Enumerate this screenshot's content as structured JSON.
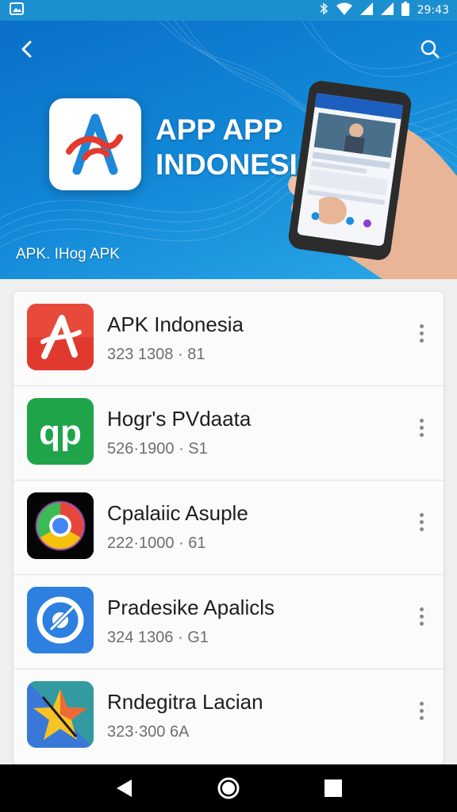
{
  "status_bar": {
    "time": "29:43",
    "icons": [
      "gallery-icon",
      "bluetooth-icon",
      "wifi-icon",
      "signal-icon",
      "signal-icon",
      "battery-icon"
    ]
  },
  "header": {
    "back_icon": "back-arrow-icon",
    "search_icon": "search-icon",
    "title_line1": "APP APP",
    "title_line2": "INDONESI",
    "subtitle": "APK. IHog APK"
  },
  "apps": [
    {
      "name": "APK Indonesia",
      "meta": "323 1308 · 81",
      "icon": "red-a-logo-icon",
      "icon_color": "#e03a2f"
    },
    {
      "name": "Hogr's PVdaata",
      "meta": "526·1900 · S1",
      "icon": "green-p-logo-icon",
      "icon_color": "#1fa44a"
    },
    {
      "name": "Cpalaiic Asuple",
      "meta": "222·1000 · 61",
      "icon": "chrome-icon",
      "icon_color": "#000000"
    },
    {
      "name": "Pradesike Apalicls",
      "meta": "324 1306 · G1",
      "icon": "blue-circle-logo-icon",
      "icon_color": "#2d7fe0"
    },
    {
      "name": "Rndegitra Lacian",
      "meta": "323·300   6A",
      "icon": "star-logo-icon",
      "icon_color": "#3a78d8"
    }
  ],
  "nav": {
    "back": "nav-back-icon",
    "home": "nav-home-icon",
    "recents": "nav-recents-icon"
  }
}
